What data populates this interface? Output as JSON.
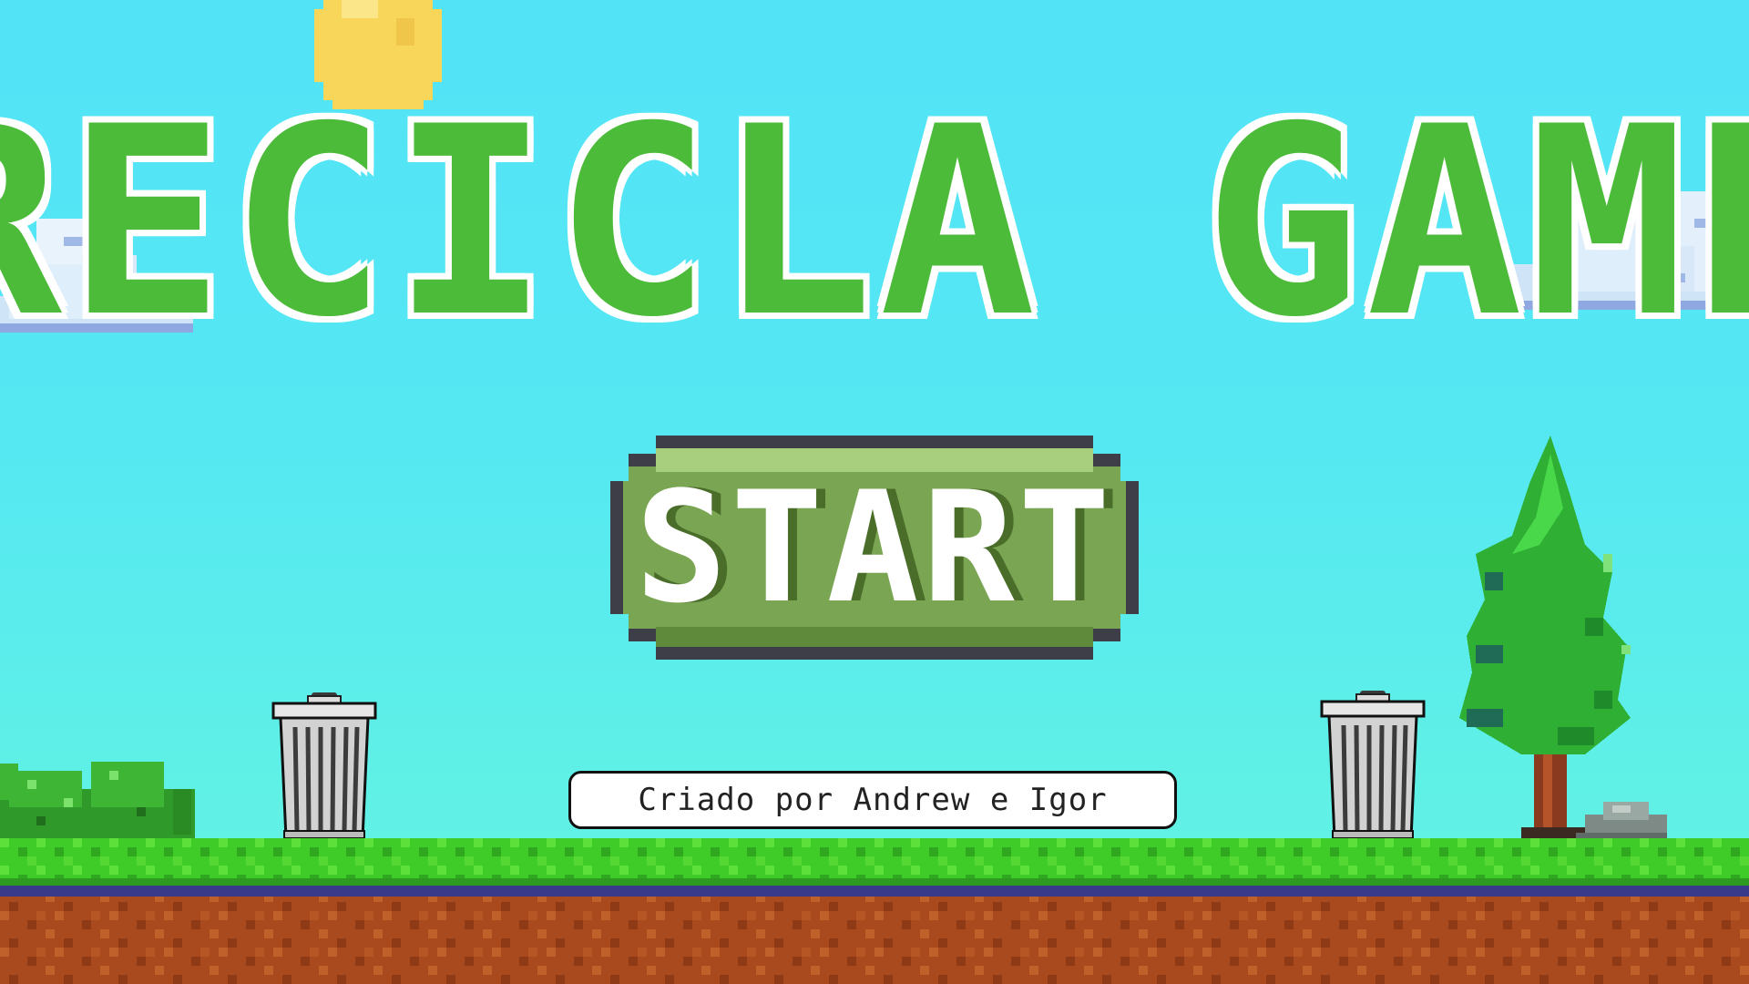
{
  "game": {
    "title": "RECICLA GAME",
    "start_label": "START",
    "credit": "Criado por Andrew e Igor"
  },
  "icons": {
    "sun": "sun-icon",
    "cloud": "cloud-icon",
    "trash": "trash-can-icon",
    "tree": "pine-tree-icon",
    "bush": "bush-icon",
    "rock": "rock-icon"
  },
  "colors": {
    "sky_top": "#52e3f7",
    "sky_bottom": "#66f3e2",
    "title_green": "#4cbb3a",
    "button_green": "#7aa653",
    "button_dark": "#3e3e48",
    "grass": "#3fcc28",
    "dirt": "#a84a1e"
  }
}
